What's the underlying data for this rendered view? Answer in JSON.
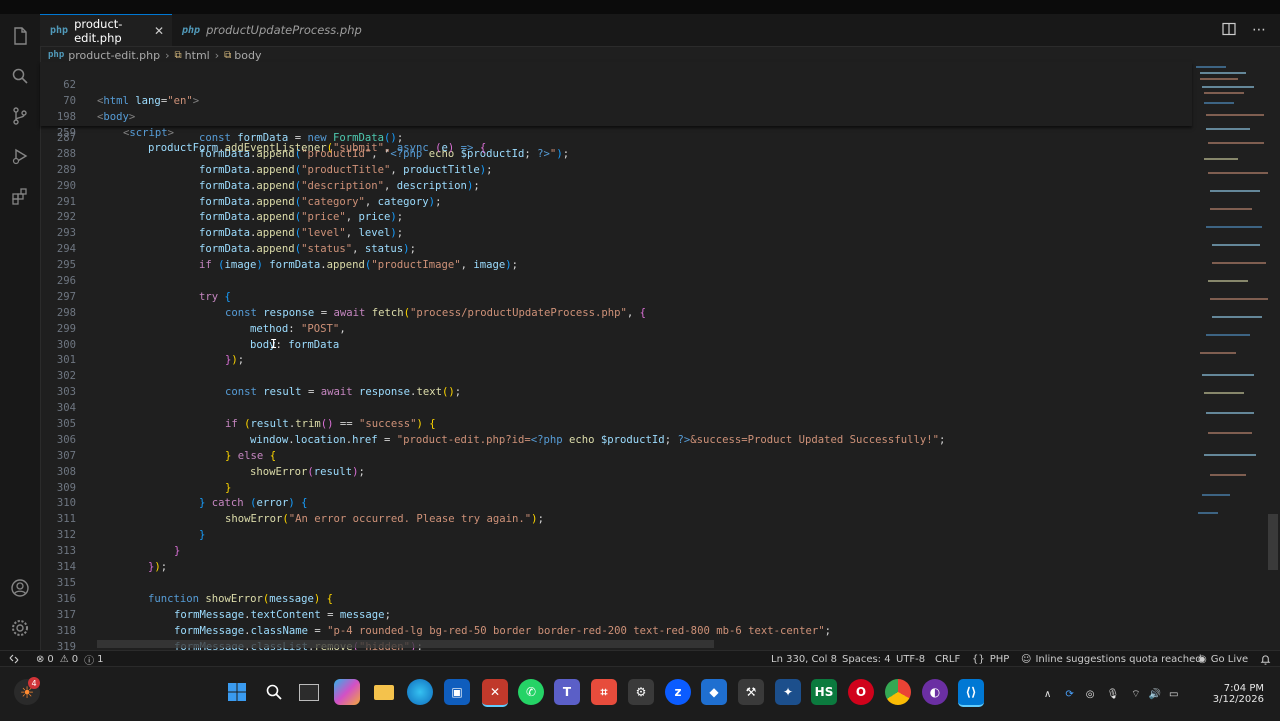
{
  "tabs": [
    {
      "label": "product-edit.php",
      "active": true
    },
    {
      "label": "productUpdateProcess.php",
      "active": false
    }
  ],
  "tab_lang_badge": "php",
  "breadcrumb": [
    "product-edit.php",
    "html",
    "body"
  ],
  "sticky_lines": [
    {
      "n": "62",
      "code": "<html lang=\"en\">"
    },
    {
      "n": "70",
      "code": "<body>"
    },
    {
      "n": "198",
      "code": "<script>"
    },
    {
      "n": "259",
      "code": "productForm.addEventListener(\"submit\", async (e) => {"
    }
  ],
  "lines": [
    {
      "n": "287",
      "code": "const formData = new FormData();"
    },
    {
      "n": "288",
      "code": "formData.append(\"productId\", \"<?php echo $productId; ?>\");"
    },
    {
      "n": "289",
      "code": "formData.append(\"productTitle\", productTitle);"
    },
    {
      "n": "290",
      "code": "formData.append(\"description\", description);"
    },
    {
      "n": "291",
      "code": "formData.append(\"category\", category);"
    },
    {
      "n": "292",
      "code": "formData.append(\"price\", price);"
    },
    {
      "n": "293",
      "code": "formData.append(\"level\", level);"
    },
    {
      "n": "294",
      "code": "formData.append(\"status\", status);"
    },
    {
      "n": "295",
      "code": "if (image) formData.append(\"productImage\", image);"
    },
    {
      "n": "296",
      "code": ""
    },
    {
      "n": "297",
      "code": "try {"
    },
    {
      "n": "298",
      "code": "const response = await fetch(\"process/productUpdateProcess.php\", {"
    },
    {
      "n": "299",
      "code": "method: \"POST\","
    },
    {
      "n": "300",
      "code": "body: formData"
    },
    {
      "n": "301",
      "code": "});"
    },
    {
      "n": "302",
      "code": ""
    },
    {
      "n": "303",
      "code": "const result = await response.text();"
    },
    {
      "n": "304",
      "code": ""
    },
    {
      "n": "305",
      "code": "if (result.trim() == \"success\") {"
    },
    {
      "n": "306",
      "code": "window.location.href = \"product-edit.php?id=<?php echo $productId; ?>&success=Product Updated Successfully!\";"
    },
    {
      "n": "307",
      "code": "} else {"
    },
    {
      "n": "308",
      "code": "showError(result);"
    },
    {
      "n": "309",
      "code": "}"
    },
    {
      "n": "310",
      "code": "} catch (error) {"
    },
    {
      "n": "311",
      "code": "showError(\"An error occurred. Please try again.\");"
    },
    {
      "n": "312",
      "code": "}"
    },
    {
      "n": "313",
      "code": "}"
    },
    {
      "n": "314",
      "code": "});"
    },
    {
      "n": "315",
      "code": ""
    },
    {
      "n": "316",
      "code": "function showError(message) {"
    },
    {
      "n": "317",
      "code": "formMessage.textContent = message;"
    },
    {
      "n": "318",
      "code": "formMessage.className = \"p-4 rounded-lg bg-red-50 border border-red-200 text-red-800 mb-6 text-center\";"
    },
    {
      "n": "319",
      "code": "formMessage.classList.remove(\"hidden\");"
    }
  ],
  "status": {
    "errors": "0",
    "warnings": "0",
    "info": "1",
    "cursor": "Ln 330, Col 8",
    "spaces": "Spaces: 4",
    "encoding": "UTF-8",
    "eol": "CRLF",
    "language": "PHP",
    "inline": "Inline suggestions quota reached",
    "golive": "Go Live"
  },
  "taskbar": {
    "notification_badge": "4",
    "time": "7:04 PM",
    "date": "3/12/2026"
  },
  "colors": {
    "editor_bg": "#1f1f1f",
    "accent": "#0078d4",
    "keyword": "#569cd6",
    "string": "#ce9178",
    "function": "#dcdcaa",
    "variable": "#9cdcfe"
  }
}
